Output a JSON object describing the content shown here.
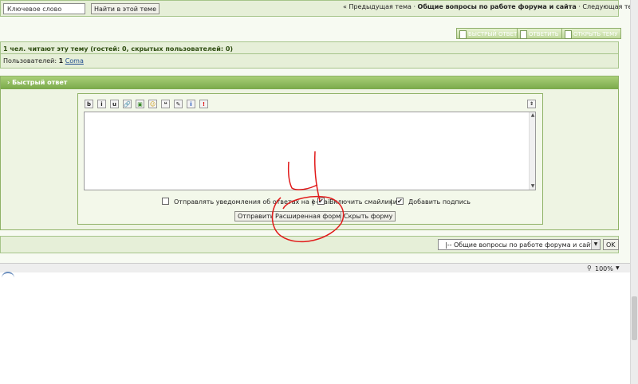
{
  "search": {
    "keyword_placeholder": "Ключевое слово",
    "button_label": "Найти в этой теме"
  },
  "topic_nav": {
    "prev_label": "« Предыдущая тема",
    "separator": "·",
    "topic_title": "Общие вопросы по работе форума и сайта",
    "next_label": "Следующая тема »"
  },
  "actions": {
    "quick_reply": "БЫСТРЫЙ ОТВЕТ",
    "reply": "ОТВЕТИТЬ",
    "new_topic": "ОТКРЫТЬ ТЕМУ"
  },
  "viewers": {
    "summary": "1 чел. читают эту тему (гостей: 0, скрытых пользователей: 0)",
    "users_label": "Пользователей:",
    "users_count": "1",
    "user_name": "Coma"
  },
  "quick_reply": {
    "header": "› Быстрый ответ",
    "toolbar": [
      {
        "name": "bold-icon",
        "glyph": "b"
      },
      {
        "name": "italic-icon",
        "glyph": "i"
      },
      {
        "name": "underline-icon",
        "glyph": "u"
      },
      {
        "name": "link-icon",
        "glyph": "🔗"
      },
      {
        "name": "image-icon",
        "glyph": "▣"
      },
      {
        "name": "emoticon-icon",
        "glyph": "☺"
      },
      {
        "name": "quote-icon",
        "glyph": "❝"
      },
      {
        "name": "spell-icon",
        "glyph": "✎"
      },
      {
        "name": "info-icon",
        "glyph": "i"
      },
      {
        "name": "warning-icon",
        "glyph": "!"
      }
    ],
    "notify_label": "Отправлять уведомления об ответах на e-mail",
    "notify_checked": false,
    "smilies_label": "Включить смайлики",
    "smilies_checked": true,
    "signature_label": "Добавить подпись",
    "signature_checked": true,
    "divider": "|",
    "send_button": "Отправить",
    "advanced_button": "Расширенная форма",
    "hide_button": "Скрыть форму"
  },
  "jump": {
    "selected": "|-- Общие вопросы по работе форума и сайта",
    "go_button": "OK"
  },
  "status_bar": {
    "zoom": "100%"
  },
  "colors": {
    "accent": "#79a94a",
    "annotation": "#e11a1a"
  }
}
